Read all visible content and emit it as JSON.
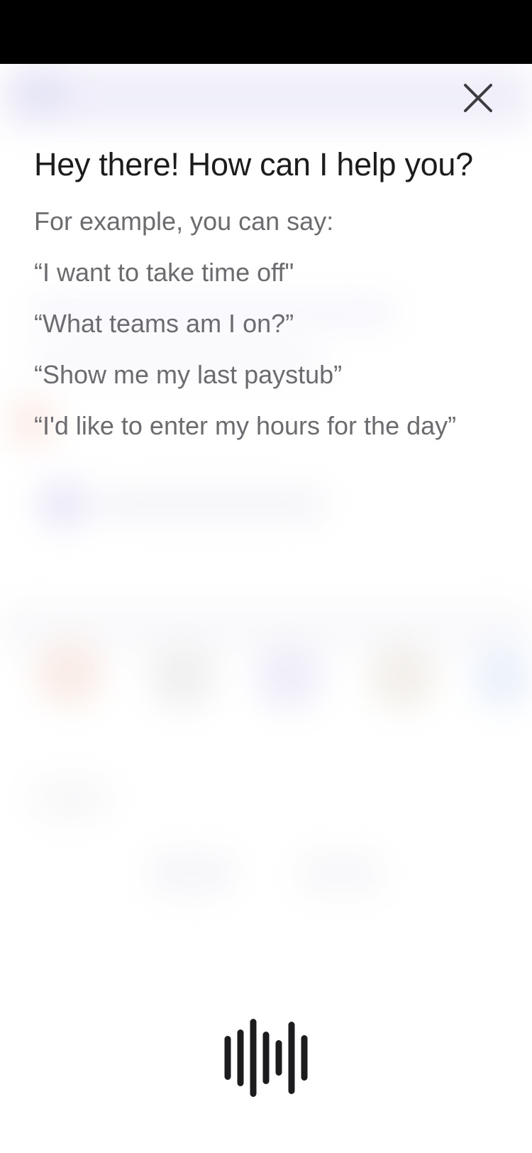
{
  "assistant": {
    "title": "Hey there! How can I help you?",
    "intro": "For example, you can say:",
    "examples": [
      "“I want to take time off\"",
      "“What teams am I on?”",
      "“Show me my last paystub”",
      "“I'd like to enter my hours for the day”"
    ]
  },
  "icons": {
    "close": "close-icon",
    "voice": "voice-waveform-icon"
  },
  "colors": {
    "title": "#1c1c1e",
    "secondary_text": "#6b6b70",
    "status_bar": "#000000",
    "background": "#ffffff"
  }
}
